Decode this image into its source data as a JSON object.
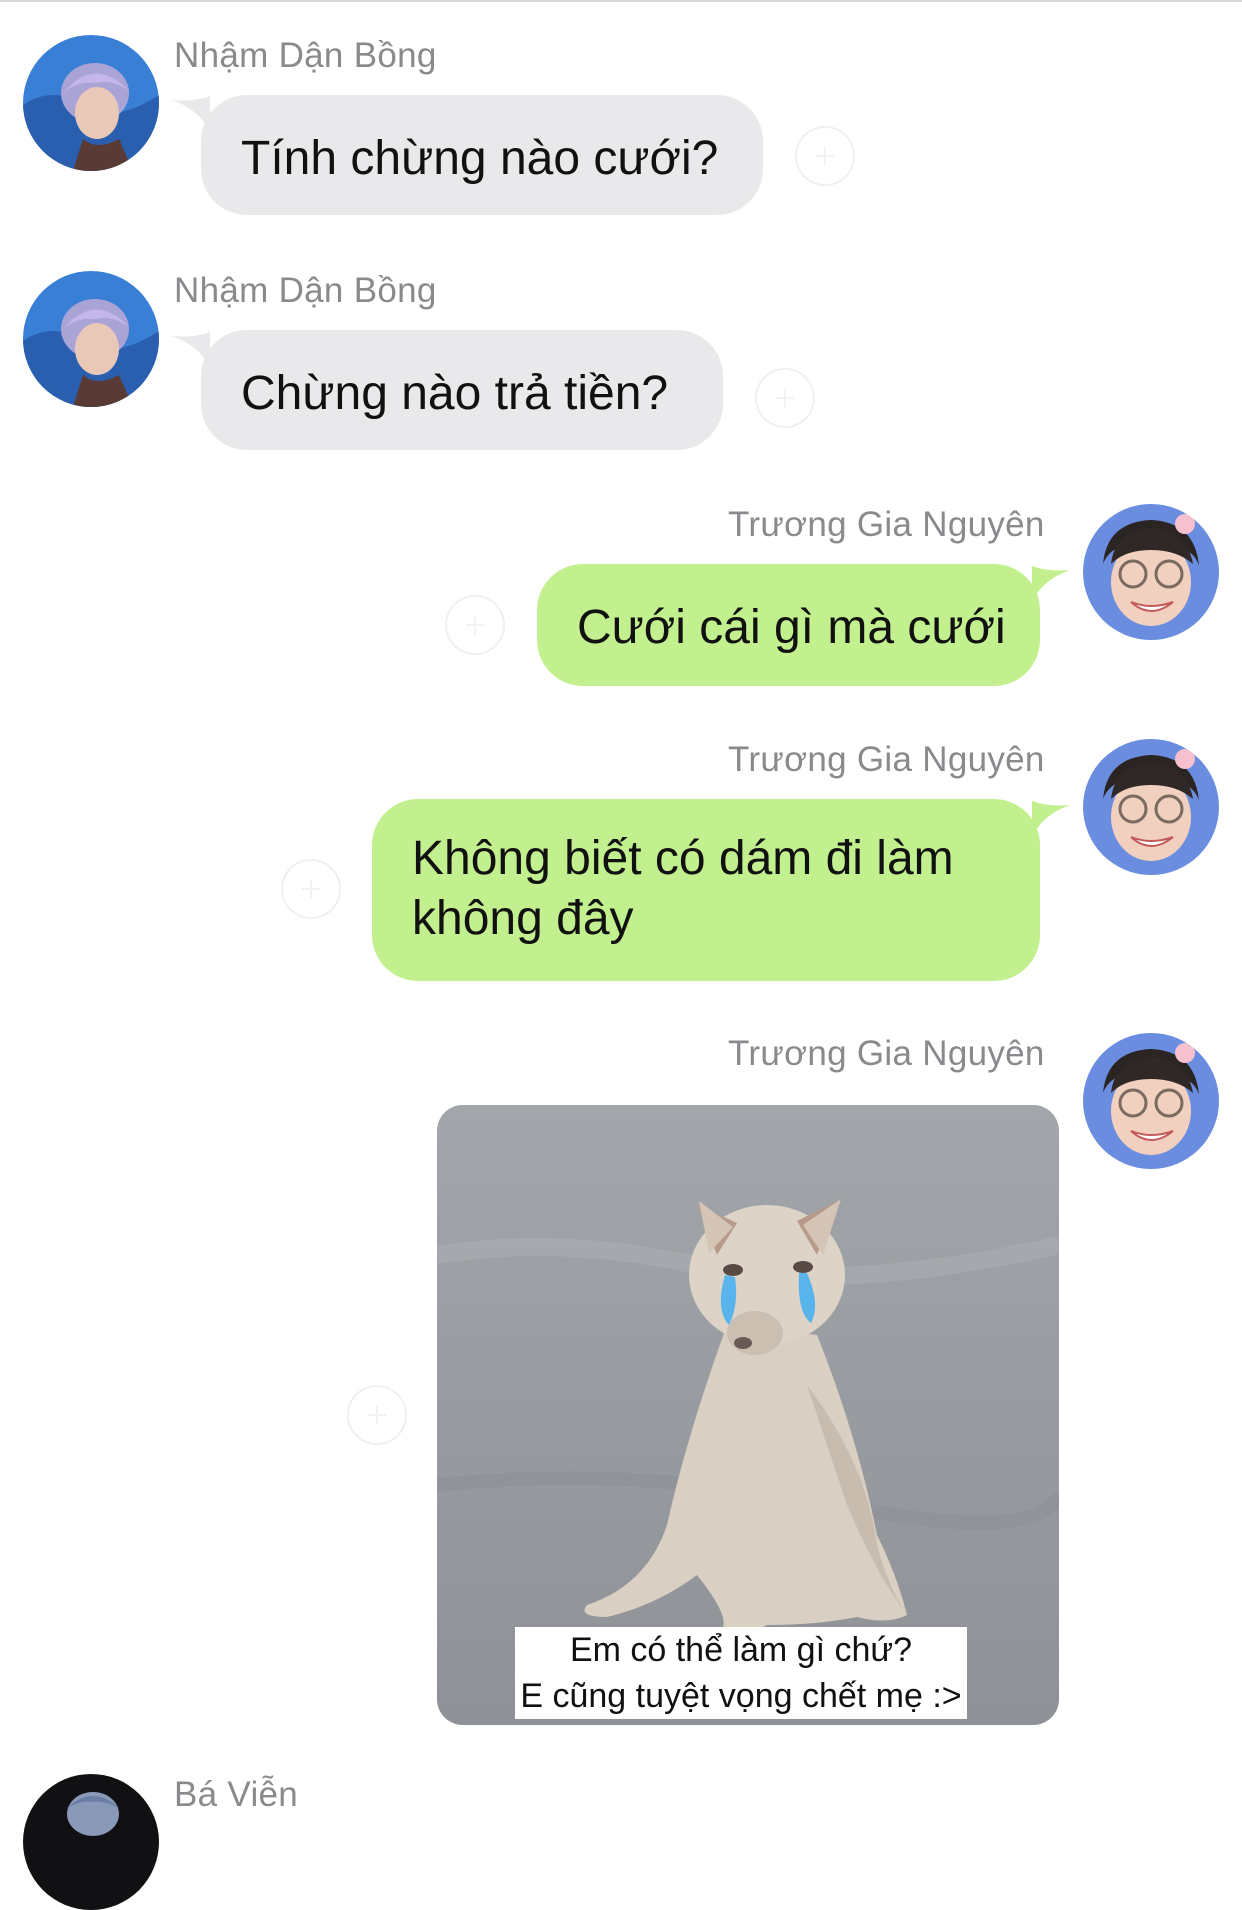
{
  "messages": [
    {
      "sender": "Nhậm Dận Bồng",
      "text": "Tính chừng nào cưới?",
      "direction": "incoming"
    },
    {
      "sender": "Nhậm Dận Bồng",
      "text": "Chừng nào trả tiền?",
      "direction": "incoming"
    },
    {
      "sender": "Trương Gia Nguyên",
      "text": "Cưới cái gì mà cưới",
      "direction": "outgoing"
    },
    {
      "sender": "Trương Gia Nguyên",
      "text_line1": "Không biết có dám đi làm",
      "text_line2": "không đây",
      "direction": "outgoing"
    },
    {
      "sender": "Trương Gia Nguyên",
      "type": "image",
      "image_caption_line1": "Em có thể làm gì chứ?",
      "image_caption_line2": "E cũng tuyệt vọng chết mẹ :>",
      "direction": "outgoing"
    },
    {
      "sender": "Bá Viễn",
      "direction": "incoming"
    }
  ],
  "colors": {
    "incoming_bubble": "#e9e9eb",
    "outgoing_bubble": "#c3f08e",
    "sender_name": "#8a8a8e",
    "background": "#ffffff"
  },
  "icons": {
    "react_button": "add-reaction-icon",
    "avatar_incoming": "avatar-nham-dan-bong",
    "avatar_outgoing": "avatar-truong-gia-nguyen",
    "avatar_last": "avatar-ba-vien"
  }
}
